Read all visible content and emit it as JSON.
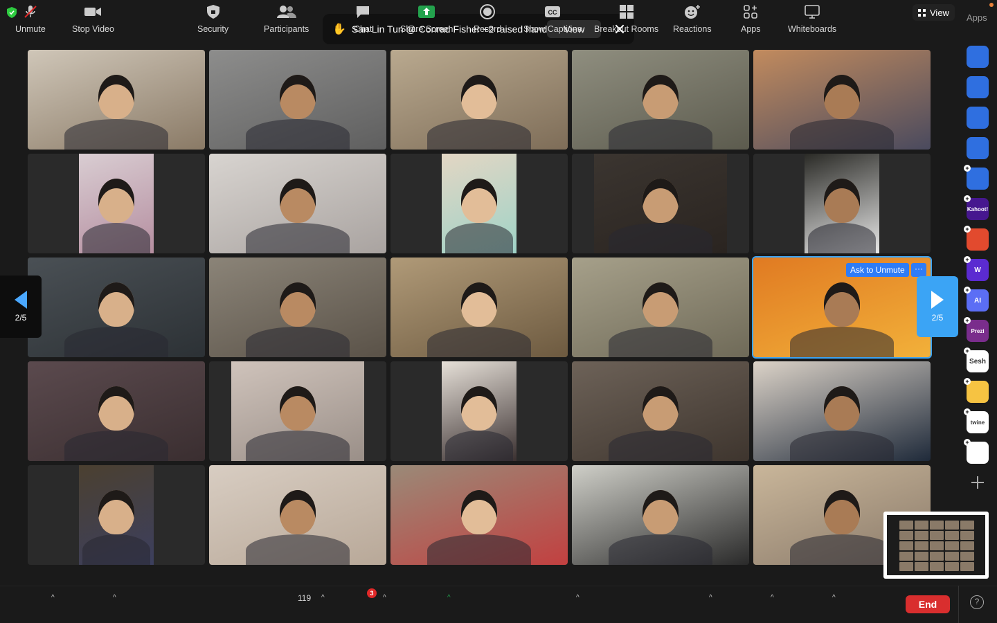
{
  "notification": {
    "text": "San Lin Tun @ Conrad Fisher +2 raised hand",
    "view_label": "View"
  },
  "top": {
    "view_label": "View",
    "apps_label": "Apps"
  },
  "nav": {
    "left_page": "2/5",
    "right_page": "2/5"
  },
  "tile_actions": {
    "ask_unmute": "Ask to Unmute",
    "more": "···"
  },
  "rail_apps": [
    {
      "name": "camera-app-icon",
      "color": "#2f6fe0",
      "label": ""
    },
    {
      "name": "music-app-icon",
      "color": "#2f6fe0",
      "label": ""
    },
    {
      "name": "timer-app-icon",
      "color": "#2f6fe0",
      "label": ""
    },
    {
      "name": "avatar-app-icon",
      "color": "#2f6fe0",
      "label": ""
    },
    {
      "name": "pitch-app-icon",
      "color": "#2f6fe0",
      "label": ""
    },
    {
      "name": "kahoot-app-icon",
      "color": "#46178f",
      "label": "Kahoot!"
    },
    {
      "name": "red-app-icon",
      "color": "#e24a2e",
      "label": ""
    },
    {
      "name": "wordwall-app-icon",
      "color": "#5b2bd1",
      "label": "W"
    },
    {
      "name": "ai-app-icon",
      "color": "#5b6ef5",
      "label": "AI"
    },
    {
      "name": "prezi-app-icon",
      "color": "#7a2d8c",
      "label": "Prezi"
    },
    {
      "name": "sesh-app-icon",
      "color": "#ffffff",
      "label": "Sesh"
    },
    {
      "name": "emoji-app-icon",
      "color": "#f6c342",
      "label": ""
    },
    {
      "name": "twine-app-icon",
      "color": "#ffffff",
      "label": "twine"
    },
    {
      "name": "blocks-app-icon",
      "color": "#ffffff",
      "label": ""
    }
  ],
  "toolbar": {
    "unmute": "Unmute",
    "stop_video": "Stop Video",
    "security": "Security",
    "participants": "Participants",
    "participant_count": "119",
    "chat": "Chat",
    "chat_badge": "3",
    "share_screen": "Share Screen",
    "record": "Record",
    "show_captions": "Show Captions",
    "breakout_rooms": "Breakout Rooms",
    "reactions": "Reactions",
    "apps": "Apps",
    "whiteboards": "Whiteboards",
    "end": "End",
    "help": "?"
  },
  "colors": {
    "accent": "#3ba4f5",
    "end_red": "#d92e2e",
    "share_green": "#23a24d"
  }
}
